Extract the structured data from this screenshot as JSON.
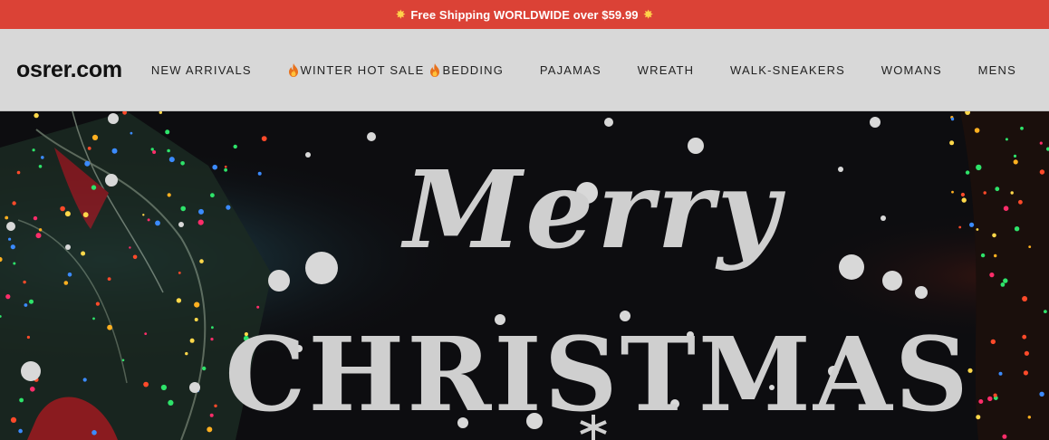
{
  "announcement": {
    "icon": "burst-icon",
    "text": "Free Shipping WORLDWIDE over $59.99"
  },
  "header": {
    "logo": "osrer.com",
    "nav": [
      {
        "label": "NEW ARRIVALS"
      },
      {
        "label": "WINTER HOT SALE",
        "icon": "fire-icon"
      },
      {
        "label": "BEDDING",
        "icon": "fire-icon"
      },
      {
        "label": "PAJAMAS"
      },
      {
        "label": "WREATH"
      },
      {
        "label": "WALK-SNEAKERS"
      },
      {
        "label": "WOMANS"
      },
      {
        "label": "MENS"
      }
    ]
  },
  "hero": {
    "line1": "Merry",
    "line2": "CHRISTMAS"
  },
  "colors": {
    "announcement_bg": "#db4236",
    "header_bg": "#d8d8d8",
    "hero_text": "#cfcfcf"
  }
}
